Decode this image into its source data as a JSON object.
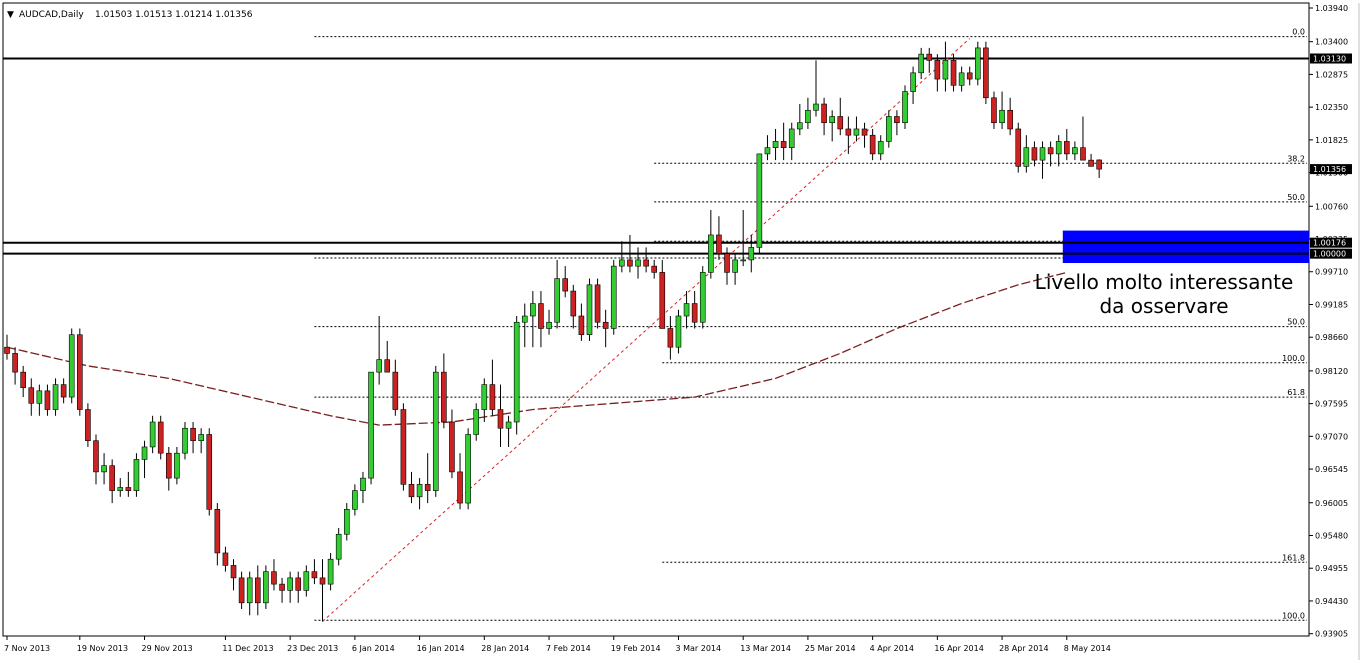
{
  "header": {
    "symbol_label": "AUDCAD,Daily",
    "ohlc_label": "1.01503 1.01513 1.01214 1.01356",
    "menu_arrow": "▼"
  },
  "annotation": {
    "line1": "Livello molto interessante",
    "line2": "da osservare"
  },
  "colors": {
    "bull": "#33cc33",
    "bear": "#cc2222",
    "wick": "#000000",
    "ma": "#7a1f1f",
    "fib": "#000000",
    "trend": "#dd2222",
    "zone": "#0000ff",
    "price_tag_bg": "#000000",
    "price_tag_fg": "#ffffff"
  },
  "chart_data": {
    "type": "candlestick",
    "ylim": [
      0.939,
      1.0394
    ],
    "y_ticks": [
      "1.03940",
      "1.03400",
      "1.02875",
      "1.02350",
      "1.01825",
      "1.01300",
      "1.00760",
      "1.00235",
      "0.99710",
      "0.99185",
      "0.98660",
      "0.98120",
      "0.97595",
      "0.97070",
      "0.96545",
      "0.96005",
      "0.95480",
      "0.94955",
      "0.94430",
      "0.93905"
    ],
    "x_ticks": [
      {
        "i": 0,
        "label": "7 Nov 2013"
      },
      {
        "i": 9,
        "label": "19 Nov 2013"
      },
      {
        "i": 17,
        "label": "29 Nov 2013"
      },
      {
        "i": 27,
        "label": "11 Dec 2013"
      },
      {
        "i": 35,
        "label": "23 Dec 2013"
      },
      {
        "i": 43,
        "label": "6 Jan 2014"
      },
      {
        "i": 51,
        "label": "16 Jan 2014"
      },
      {
        "i": 59,
        "label": "28 Jan 2014"
      },
      {
        "i": 67,
        "label": "7 Feb 2014"
      },
      {
        "i": 75,
        "label": "19 Feb 2014"
      },
      {
        "i": 83,
        "label": "3 Mar 2014"
      },
      {
        "i": 91,
        "label": "13 Mar 2014"
      },
      {
        "i": 99,
        "label": "25 Mar 2014"
      },
      {
        "i": 107,
        "label": "4 Apr 2014"
      },
      {
        "i": 115,
        "label": "16 Apr 2014"
      },
      {
        "i": 123,
        "label": "28 Apr 2014"
      },
      {
        "i": 131,
        "label": "8 May 2014"
      }
    ],
    "candles": [
      [
        0.985,
        0.987,
        0.983,
        0.984
      ],
      [
        0.984,
        0.985,
        0.979,
        0.981
      ],
      [
        0.981,
        0.982,
        0.977,
        0.9785
      ],
      [
        0.9785,
        0.98,
        0.974,
        0.976
      ],
      [
        0.976,
        0.979,
        0.974,
        0.978
      ],
      [
        0.978,
        0.979,
        0.974,
        0.975
      ],
      [
        0.975,
        0.98,
        0.974,
        0.979
      ],
      [
        0.979,
        0.98,
        0.976,
        0.977
      ],
      [
        0.977,
        0.988,
        0.976,
        0.987
      ],
      [
        0.987,
        0.988,
        0.974,
        0.975
      ],
      [
        0.975,
        0.976,
        0.969,
        0.97
      ],
      [
        0.97,
        0.971,
        0.963,
        0.965
      ],
      [
        0.965,
        0.968,
        0.963,
        0.966
      ],
      [
        0.966,
        0.967,
        0.96,
        0.962
      ],
      [
        0.962,
        0.964,
        0.961,
        0.9625
      ],
      [
        0.9625,
        0.965,
        0.961,
        0.962
      ],
      [
        0.962,
        0.968,
        0.961,
        0.967
      ],
      [
        0.967,
        0.97,
        0.964,
        0.969
      ],
      [
        0.969,
        0.974,
        0.968,
        0.973
      ],
      [
        0.973,
        0.974,
        0.967,
        0.968
      ],
      [
        0.968,
        0.969,
        0.962,
        0.964
      ],
      [
        0.964,
        0.969,
        0.963,
        0.968
      ],
      [
        0.968,
        0.973,
        0.967,
        0.972
      ],
      [
        0.972,
        0.973,
        0.968,
        0.97
      ],
      [
        0.97,
        0.972,
        0.968,
        0.971
      ],
      [
        0.971,
        0.972,
        0.958,
        0.959
      ],
      [
        0.959,
        0.96,
        0.95,
        0.952
      ],
      [
        0.952,
        0.953,
        0.949,
        0.95
      ],
      [
        0.95,
        0.951,
        0.946,
        0.948
      ],
      [
        0.948,
        0.949,
        0.943,
        0.944
      ],
      [
        0.944,
        0.949,
        0.942,
        0.948
      ],
      [
        0.948,
        0.95,
        0.942,
        0.944
      ],
      [
        0.944,
        0.95,
        0.943,
        0.949
      ],
      [
        0.949,
        0.951,
        0.946,
        0.947
      ],
      [
        0.947,
        0.948,
        0.944,
        0.946
      ],
      [
        0.946,
        0.949,
        0.944,
        0.948
      ],
      [
        0.948,
        0.949,
        0.944,
        0.946
      ],
      [
        0.946,
        0.95,
        0.945,
        0.949
      ],
      [
        0.949,
        0.951,
        0.947,
        0.948
      ],
      [
        0.948,
        0.951,
        0.941,
        0.947
      ],
      [
        0.947,
        0.952,
        0.946,
        0.951
      ],
      [
        0.951,
        0.956,
        0.95,
        0.955
      ],
      [
        0.955,
        0.96,
        0.954,
        0.959
      ],
      [
        0.959,
        0.963,
        0.958,
        0.962
      ],
      [
        0.962,
        0.965,
        0.96,
        0.964
      ],
      [
        0.964,
        0.974,
        0.963,
        0.981
      ],
      [
        0.981,
        0.99,
        0.979,
        0.983
      ],
      [
        0.983,
        0.986,
        0.981,
        0.981
      ],
      [
        0.981,
        0.983,
        0.974,
        0.975
      ],
      [
        0.975,
        0.976,
        0.962,
        0.963
      ],
      [
        0.963,
        0.965,
        0.96,
        0.961
      ],
      [
        0.961,
        0.964,
        0.959,
        0.963
      ],
      [
        0.963,
        0.968,
        0.96,
        0.962
      ],
      [
        0.962,
        0.982,
        0.961,
        0.981
      ],
      [
        0.981,
        0.984,
        0.972,
        0.973
      ],
      [
        0.973,
        0.975,
        0.964,
        0.965
      ],
      [
        0.965,
        0.968,
        0.959,
        0.96
      ],
      [
        0.96,
        0.972,
        0.959,
        0.971
      ],
      [
        0.971,
        0.976,
        0.97,
        0.975
      ],
      [
        0.975,
        0.98,
        0.973,
        0.979
      ],
      [
        0.979,
        0.983,
        0.974,
        0.975
      ],
      [
        0.975,
        0.979,
        0.969,
        0.972
      ],
      [
        0.972,
        0.974,
        0.969,
        0.973
      ],
      [
        0.973,
        0.99,
        0.971,
        0.989
      ],
      [
        0.989,
        0.992,
        0.985,
        0.99
      ],
      [
        0.99,
        0.994,
        0.985,
        0.992
      ],
      [
        0.992,
        0.994,
        0.985,
        0.988
      ],
      [
        0.988,
        0.991,
        0.987,
        0.989
      ],
      [
        0.989,
        0.999,
        0.988,
        0.996
      ],
      [
        0.996,
        0.998,
        0.993,
        0.994
      ],
      [
        0.994,
        0.995,
        0.988,
        0.99
      ],
      [
        0.99,
        0.992,
        0.986,
        0.987
      ],
      [
        0.987,
        0.996,
        0.986,
        0.995
      ],
      [
        0.995,
        0.996,
        0.988,
        0.989
      ],
      [
        0.989,
        0.991,
        0.985,
        0.988
      ],
      [
        0.988,
        0.999,
        0.987,
        0.998
      ],
      [
        0.998,
        1.002,
        0.997,
        0.999
      ],
      [
        0.999,
        1.003,
        0.997,
        0.998
      ],
      [
        0.998,
        1.001,
        0.996,
        0.999
      ],
      [
        0.999,
        1.001,
        0.997,
        0.998
      ],
      [
        0.998,
        0.999,
        0.996,
        0.997
      ],
      [
        0.997,
        0.999,
        0.988,
        0.988
      ],
      [
        0.988,
        0.99,
        0.983,
        0.985
      ],
      [
        0.985,
        0.991,
        0.984,
        0.99
      ],
      [
        0.99,
        0.994,
        0.988,
        0.992
      ],
      [
        0.992,
        0.994,
        0.988,
        0.989
      ],
      [
        0.989,
        0.998,
        0.988,
        0.997
      ],
      [
        0.997,
        1.007,
        0.996,
        1.003
      ],
      [
        1.003,
        1.006,
        0.999,
        1.0
      ],
      [
        1.0,
        1.001,
        0.995,
        0.997
      ],
      [
        0.997,
        1.0,
        0.995,
        0.999
      ],
      [
        0.999,
        1.007,
        0.998,
        0.999
      ],
      [
        0.999,
        1.003,
        0.997,
        1.001
      ],
      [
        1.001,
        1.01,
        1.0,
        1.016
      ],
      [
        1.016,
        1.019,
        1.015,
        1.017
      ],
      [
        1.017,
        1.02,
        1.015,
        1.018
      ],
      [
        1.018,
        1.021,
        1.015,
        1.017
      ],
      [
        1.017,
        1.021,
        1.015,
        1.02
      ],
      [
        1.02,
        1.024,
        1.019,
        1.021
      ],
      [
        1.021,
        1.025,
        1.02,
        1.023
      ],
      [
        1.023,
        1.031,
        1.022,
        1.024
      ],
      [
        1.024,
        1.025,
        1.019,
        1.021
      ],
      [
        1.021,
        1.023,
        1.018,
        1.022
      ],
      [
        1.022,
        1.025,
        1.019,
        1.02
      ],
      [
        1.02,
        1.022,
        1.016,
        1.019
      ],
      [
        1.019,
        1.022,
        1.018,
        1.02
      ],
      [
        1.02,
        1.021,
        1.017,
        1.019
      ],
      [
        1.019,
        1.02,
        1.015,
        1.016
      ],
      [
        1.016,
        1.019,
        1.015,
        1.018
      ],
      [
        1.018,
        1.023,
        1.017,
        1.022
      ],
      [
        1.022,
        1.023,
        1.019,
        1.021
      ],
      [
        1.021,
        1.027,
        1.02,
        1.026
      ],
      [
        1.026,
        1.03,
        1.024,
        1.029
      ],
      [
        1.029,
        1.033,
        1.028,
        1.032
      ],
      [
        1.032,
        1.033,
        1.029,
        1.031
      ],
      [
        1.031,
        1.032,
        1.026,
        1.028
      ],
      [
        1.028,
        1.034,
        1.026,
        1.031
      ],
      [
        1.031,
        1.032,
        1.026,
        1.027
      ],
      [
        1.027,
        1.03,
        1.026,
        1.029
      ],
      [
        1.029,
        1.03,
        1.027,
        1.028
      ],
      [
        1.028,
        1.034,
        1.027,
        1.033
      ],
      [
        1.033,
        1.034,
        1.024,
        1.025
      ],
      [
        1.025,
        1.026,
        1.02,
        1.021
      ],
      [
        1.021,
        1.026,
        1.02,
        1.023
      ],
      [
        1.023,
        1.025,
        1.019,
        1.02
      ],
      [
        1.02,
        1.021,
        1.013,
        1.014
      ],
      [
        1.014,
        1.019,
        1.013,
        1.017
      ],
      [
        1.017,
        1.018,
        1.014,
        1.015
      ],
      [
        1.015,
        1.018,
        1.012,
        1.017
      ],
      [
        1.017,
        1.018,
        1.014,
        1.016
      ],
      [
        1.016,
        1.019,
        1.014,
        1.018
      ],
      [
        1.018,
        1.02,
        1.015,
        1.016
      ],
      [
        1.016,
        1.018,
        1.015,
        1.017
      ],
      [
        1.017,
        1.022,
        1.015,
        1.015
      ],
      [
        1.015,
        1.016,
        1.014,
        1.014
      ],
      [
        1.01503,
        1.01513,
        1.01214,
        1.01356
      ]
    ],
    "moving_average": [
      [
        0,
        0.985
      ],
      [
        10,
        0.982
      ],
      [
        20,
        0.98
      ],
      [
        30,
        0.977
      ],
      [
        40,
        0.974
      ],
      [
        46,
        0.9725
      ],
      [
        55,
        0.973
      ],
      [
        65,
        0.975
      ],
      [
        75,
        0.976
      ],
      [
        85,
        0.977
      ],
      [
        95,
        0.98
      ],
      [
        103,
        0.984
      ],
      [
        110,
        0.988
      ],
      [
        118,
        0.992
      ],
      [
        125,
        0.995
      ],
      [
        131,
        0.997
      ]
    ],
    "trendline": [
      [
        39,
        0.941
      ],
      [
        119,
        1.0345
      ]
    ],
    "horizontal_levels": [
      {
        "price": 1.0313,
        "label": "1.03130"
      },
      {
        "price": 1.00176,
        "label": "1.00176"
      },
      {
        "price": 1.0,
        "label": "1.00000"
      }
    ],
    "current_price": {
      "price": 1.01356,
      "label": "1.01356"
    },
    "fib_levels": [
      {
        "price": 1.0348,
        "label": "0.0",
        "x_start_i": 38
      },
      {
        "price": 1.0145,
        "label": "38.2",
        "x_start_i": 80
      },
      {
        "price": 1.0083,
        "label": "50.0",
        "x_start_i": 80
      },
      {
        "price": 1.002,
        "label": "61.8",
        "x_start_i": 80
      },
      {
        "price": 0.9993,
        "label": "100.0",
        "x_start_i": 38
      },
      {
        "price": 0.9883,
        "label": "50.0",
        "x_start_i": 38
      },
      {
        "price": 0.9825,
        "label": "100.0",
        "x_start_i": 81
      },
      {
        "price": 0.977,
        "label": "61.8",
        "x_start_i": 38
      },
      {
        "price": 0.9505,
        "label": "161.8",
        "x_start_i": 81
      },
      {
        "price": 0.9412,
        "label": "100.0",
        "x_start_i": 38
      }
    ],
    "zone": {
      "start_i": 131,
      "top": 1.0037,
      "bottom": 0.9985
    }
  }
}
